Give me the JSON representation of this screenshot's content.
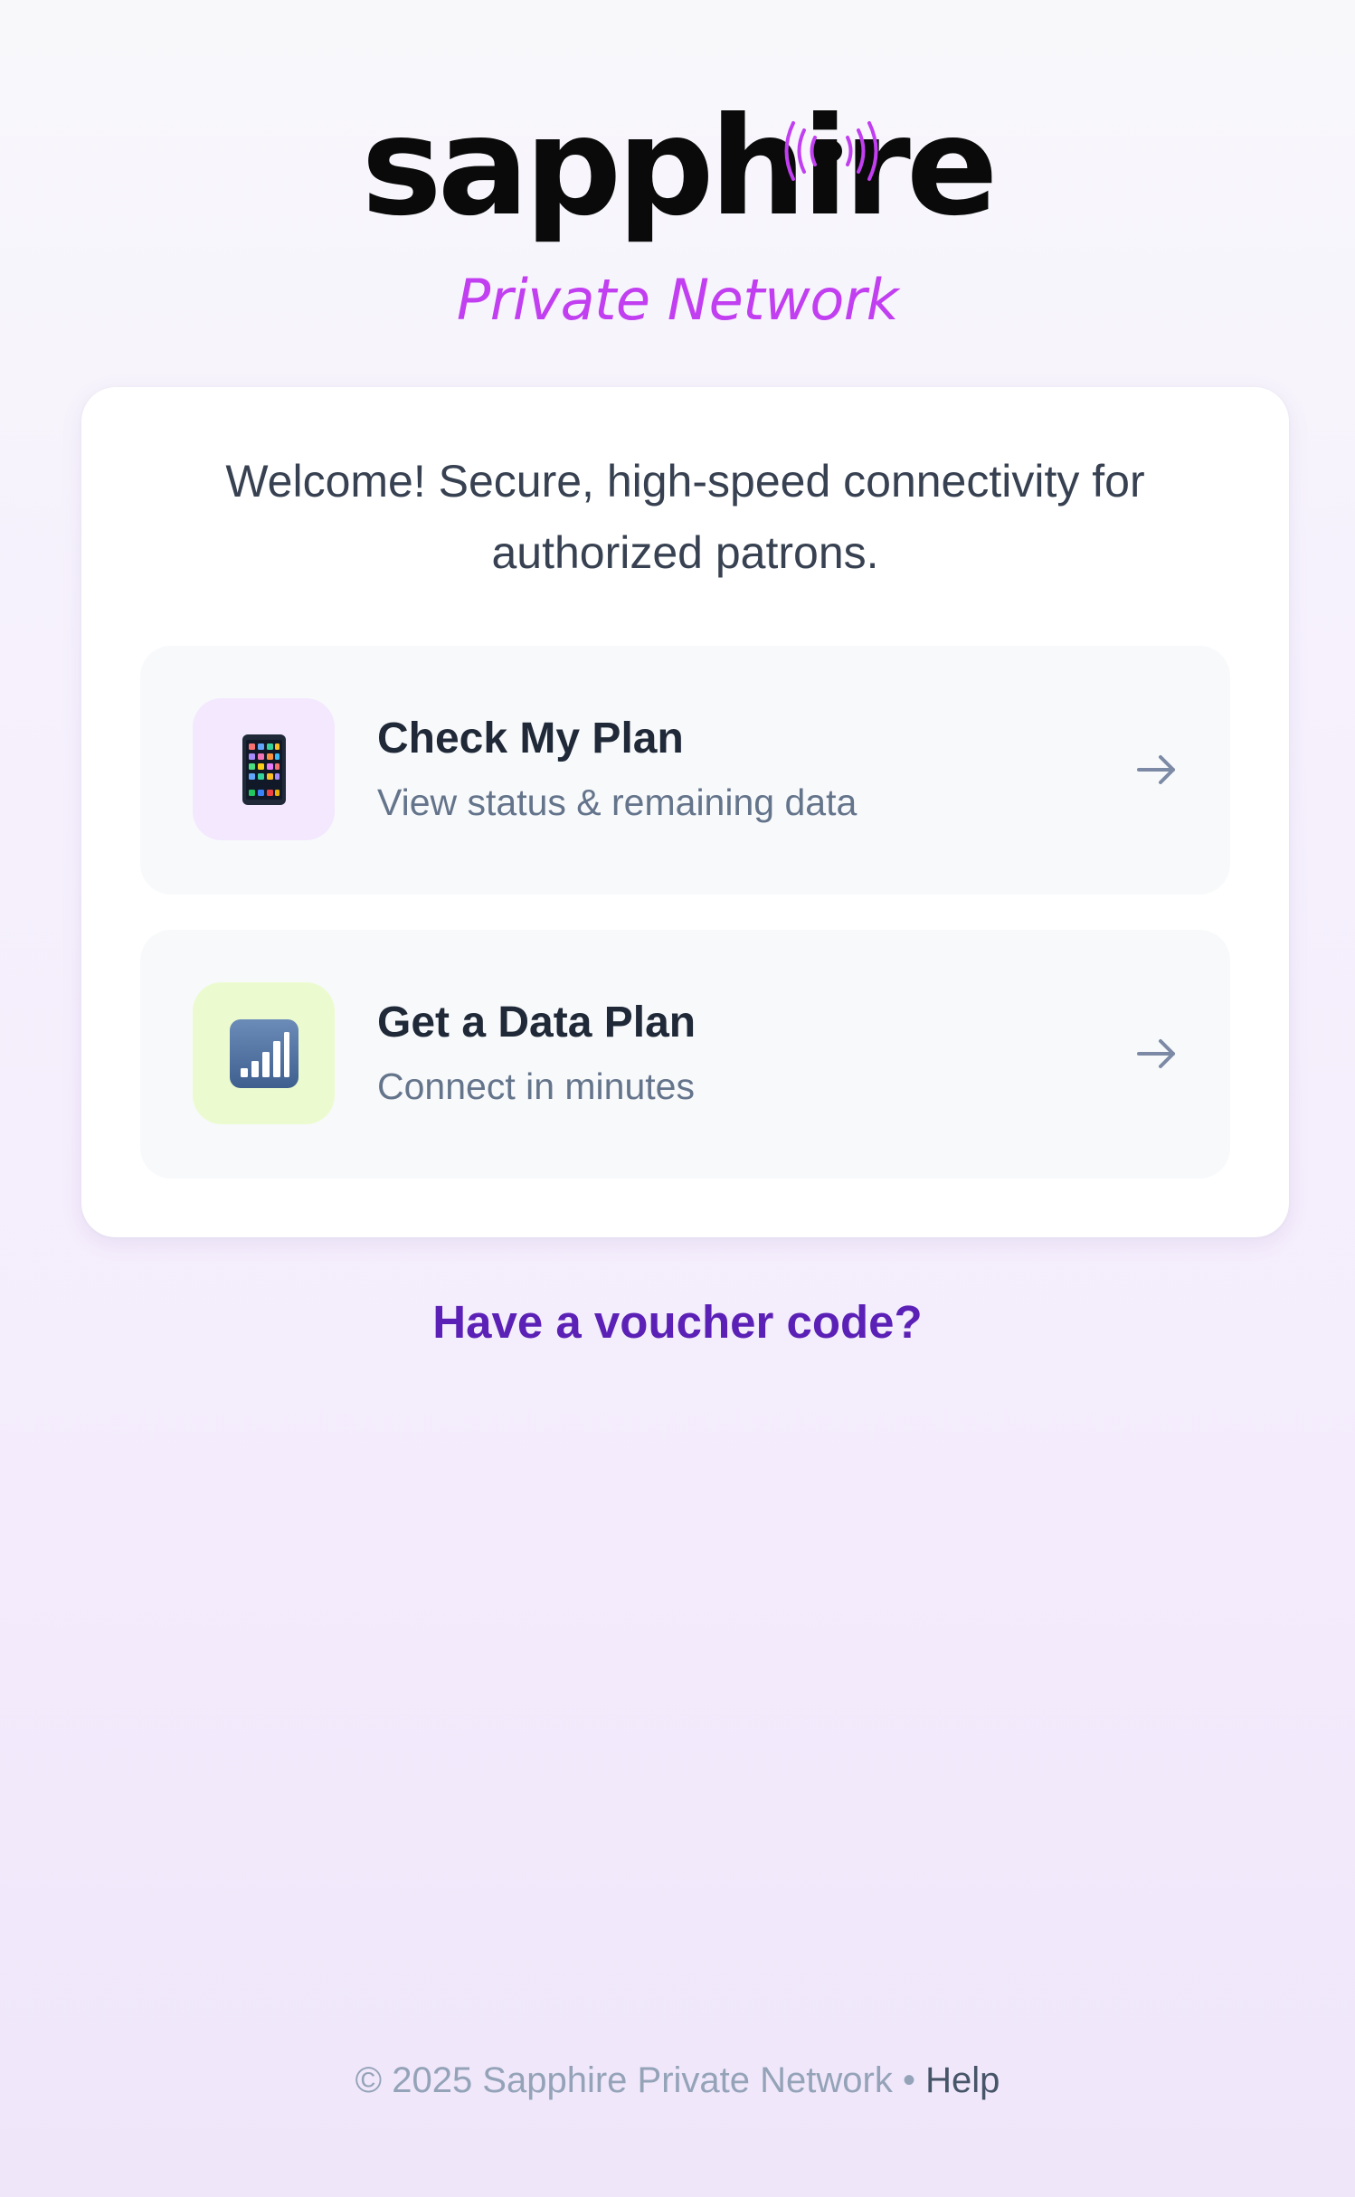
{
  "logo": {
    "wordmark": "sapphire",
    "tagline": "Private Network",
    "icon": "broadcast-signal-icon"
  },
  "card": {
    "welcome": "Welcome! Secure, high-speed connectivity for authorized patrons.",
    "options": [
      {
        "title": "Check My Plan",
        "subtitle": "View status & remaining data",
        "icon": "mobile-phone-icon",
        "arrow": "arrow-right-icon"
      },
      {
        "title": "Get a Data Plan",
        "subtitle": "Connect in minutes",
        "icon": "signal-bars-icon",
        "arrow": "arrow-right-icon"
      }
    ]
  },
  "voucher_link": "Have a voucher code?",
  "footer": {
    "copyright": "© 2025 Sapphire Private Network",
    "separator": "•",
    "help_link": "Help"
  },
  "colors": {
    "brand_accent": "#c13ff0",
    "link": "#5b21b6",
    "card_background": "#ffffff",
    "option_background": "#f8f9fb"
  }
}
